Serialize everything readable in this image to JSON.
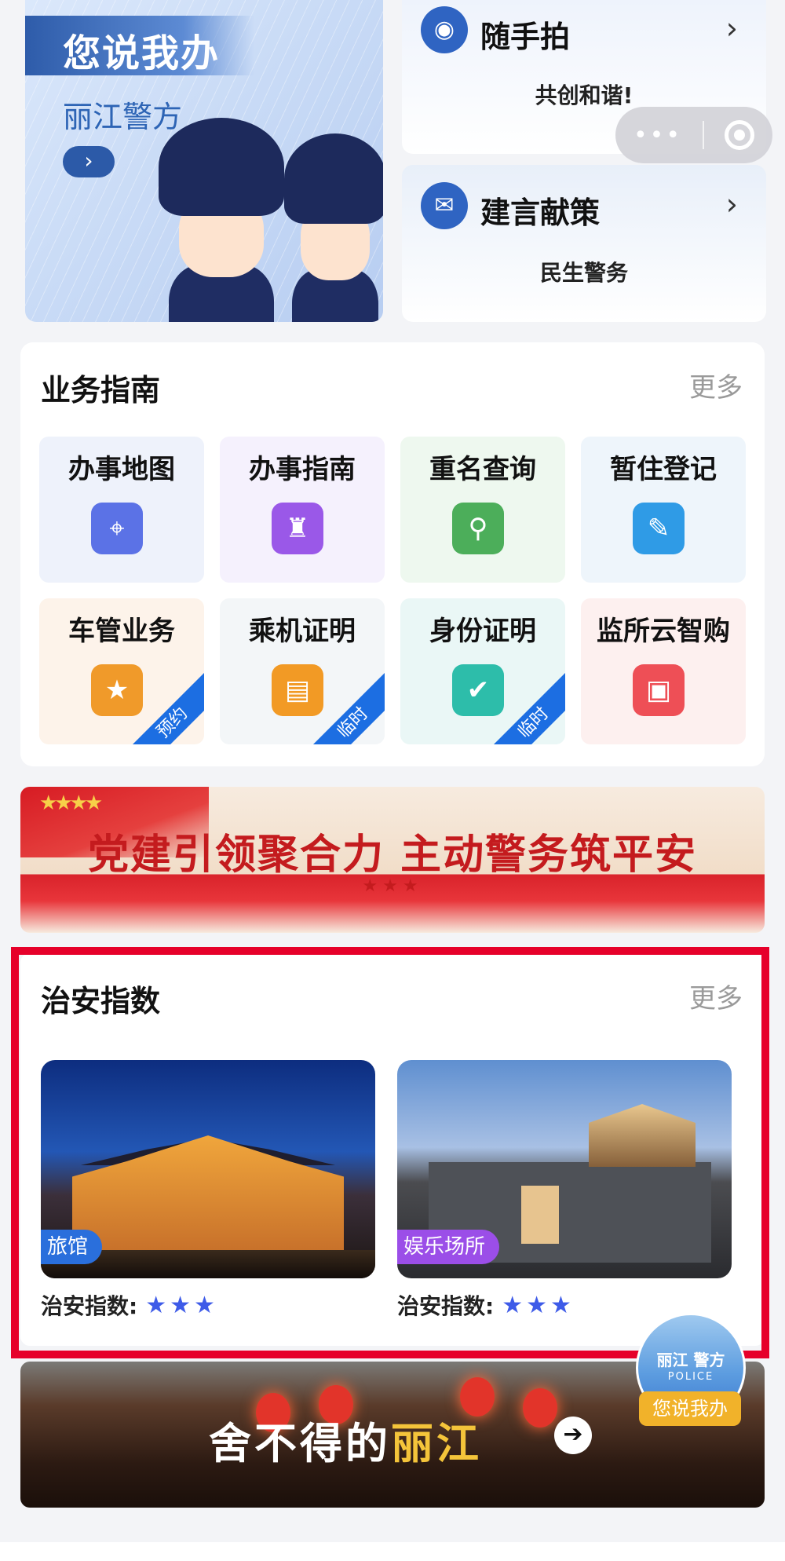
{
  "hero": {
    "title": "您说我办",
    "subtitle": "丽江警方",
    "arrow": "›"
  },
  "quick_cards": [
    {
      "icon": "camera-icon",
      "icon_glyph": "◉",
      "title": "随手拍",
      "desc": "共创和谐!"
    },
    {
      "icon": "mail-icon",
      "icon_glyph": "✉",
      "title": "建言献策",
      "desc": "民生警务"
    }
  ],
  "chevron": "›",
  "capsule": {
    "dots": "•••"
  },
  "guide": {
    "title": "业务指南",
    "more": "更多",
    "items": [
      {
        "label": "办事地图",
        "icon": "map-pin-icon",
        "glyph": "⌖",
        "bg": "#eef2fb",
        "color": "#5b72e6",
        "ribbon": ""
      },
      {
        "label": "办事指南",
        "icon": "sitemap-icon",
        "glyph": "♜",
        "bg": "#f5f1fd",
        "color": "#9a58e8",
        "ribbon": ""
      },
      {
        "label": "重名查询",
        "icon": "search-person-icon",
        "glyph": "⚲",
        "bg": "#eef8ef",
        "color": "#4cae5a",
        "ribbon": ""
      },
      {
        "label": "暂住登记",
        "icon": "edit-icon",
        "glyph": "✎",
        "bg": "#eef5fb",
        "color": "#2f9be6",
        "ribbon": ""
      },
      {
        "label": "车管业务",
        "icon": "shield-star-icon",
        "glyph": "★",
        "bg": "#fdf3ea",
        "color": "#f09a2a",
        "ribbon": "预约"
      },
      {
        "label": "乘机证明",
        "icon": "document-icon",
        "glyph": "▤",
        "bg": "#f3f6f8",
        "color": "#f29a25",
        "ribbon": "临时"
      },
      {
        "label": "身份证明",
        "icon": "id-user-icon",
        "glyph": "✔",
        "bg": "#eaf7f6",
        "color": "#2dbdaa",
        "ribbon": "临时"
      },
      {
        "label": "监所云智购",
        "icon": "briefcase-icon",
        "glyph": "▣",
        "bg": "#fdf0ef",
        "color": "#ee4f56",
        "ribbon": ""
      }
    ]
  },
  "party_banner": {
    "text": "党建引领聚合力 主动警务筑平安",
    "stars": "★★★",
    "flag_stars": "★★★★"
  },
  "security": {
    "title": "治安指数",
    "more": "更多",
    "venues": [
      {
        "tag": "旅馆",
        "tag_color": "blue",
        "index_label": "治安指数:",
        "rating": 3
      },
      {
        "tag": "娱乐场所",
        "tag_color": "purple",
        "index_label": "治安指数:",
        "rating": 3
      }
    ]
  },
  "float_badge": {
    "brand": "丽江 警方",
    "police": "POLICE",
    "cta": "您说我办"
  },
  "lijiang_banner": {
    "text_a": "舍不得的",
    "text_b": "丽江",
    "arrow": "➔"
  }
}
